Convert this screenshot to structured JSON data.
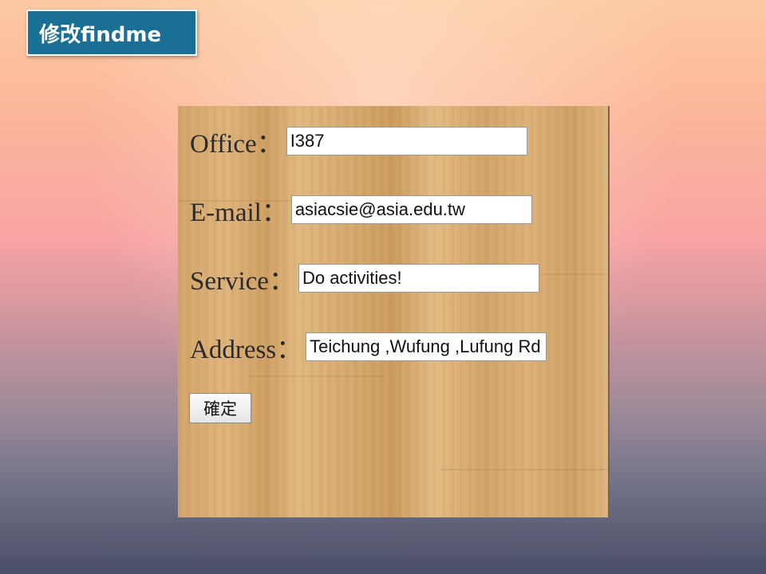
{
  "slide": {
    "title": "修改findme"
  },
  "form": {
    "fields": [
      {
        "label": "Office：",
        "value": "I387"
      },
      {
        "label": "E-mail：",
        "value": "asiacsie@asia.edu.tw"
      },
      {
        "label": "Service：",
        "value": "Do activities!"
      },
      {
        "label": "Address：",
        "value": "Teichung ,Wufung ,Lufung Rd"
      }
    ],
    "submit_label": "確定"
  }
}
